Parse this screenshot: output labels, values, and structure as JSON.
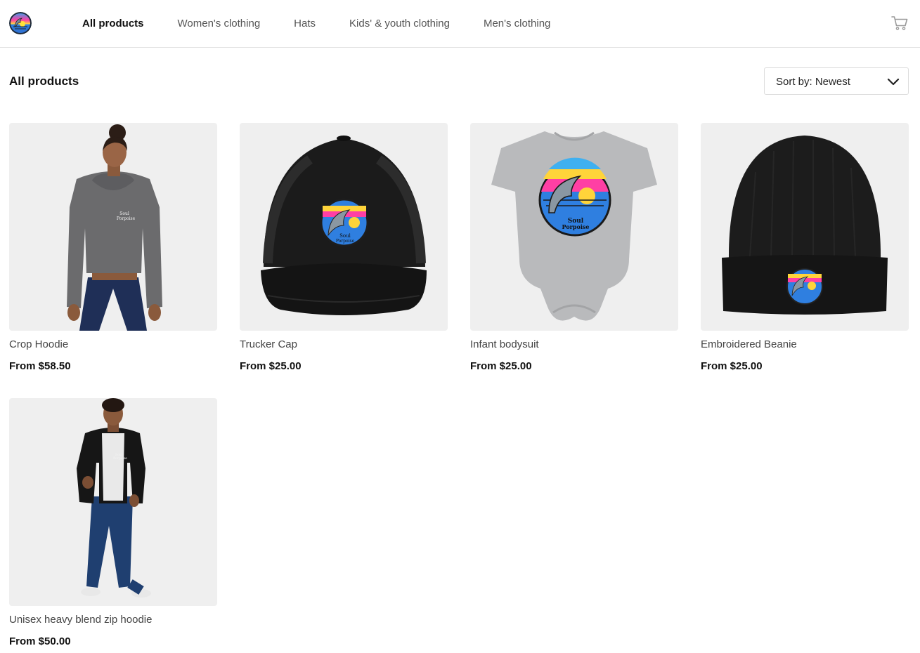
{
  "header": {
    "nav": [
      {
        "label": "All products",
        "active": true
      },
      {
        "label": "Women's clothing",
        "active": false
      },
      {
        "label": "Hats",
        "active": false
      },
      {
        "label": "Kids' & youth clothing",
        "active": false
      },
      {
        "label": "Men's clothing",
        "active": false
      }
    ],
    "cart_icon": "shopping-cart-icon",
    "logo_icon": "dolphin-sunset-logo"
  },
  "main": {
    "title": "All products",
    "sort": {
      "label": "Sort by: Newest",
      "icon": "chevron-down-icon"
    }
  },
  "products": [
    {
      "name": "Crop Hoodie",
      "price": "From $58.50"
    },
    {
      "name": "Trucker Cap",
      "price": "From $25.00"
    },
    {
      "name": "Infant bodysuit",
      "price": "From $25.00"
    },
    {
      "name": "Embroidered Beanie",
      "price": "From $25.00"
    },
    {
      "name": "Unisex heavy blend zip hoodie",
      "price": "From $50.00"
    }
  ],
  "colors": {
    "background": "#ffffff",
    "image_bg": "#efefef",
    "text_primary": "#111111",
    "text_secondary": "#555555",
    "divider": "#e2e2e2"
  }
}
